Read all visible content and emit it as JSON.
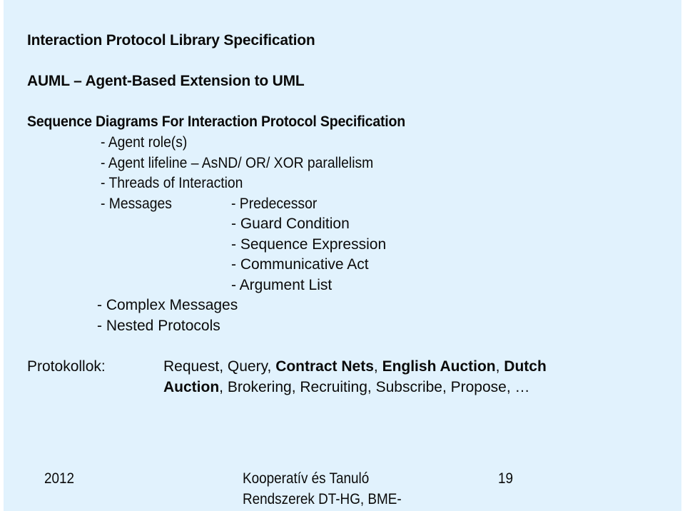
{
  "slide": {
    "headings": [
      "Interaction Protocol Library Specification",
      "AUML – Agent-Based Extension to UML",
      "Sequence Diagrams For Interaction Protocol Specification"
    ],
    "sequence_items": [
      "- Agent role(s)",
      "- Agent lifeline – AsND/ OR/ XOR parallelism",
      "- Threads of Interaction",
      "- Messages"
    ],
    "message_subitems": [
      "- Predecessor",
      "- Guard Condition",
      "- Sequence Expression",
      "- Communicative Act",
      "- Argument List"
    ],
    "more_items": [
      "- Complex Messages",
      "- Nested Protocols"
    ],
    "protocols": {
      "label": "Protokollok:",
      "line1": [
        {
          "text": "Request, Query, ",
          "bold": false
        },
        {
          "text": "Contract Nets",
          "bold": true
        },
        {
          "text": ", ",
          "bold": false
        },
        {
          "text": "English Auction",
          "bold": true
        },
        {
          "text": ", ",
          "bold": false
        },
        {
          "text": "Dutch",
          "bold": true
        }
      ],
      "line2": [
        {
          "text": "Auction",
          "bold": true
        },
        {
          "text": ", Brokering, Recruiting, Subscribe, Propose, …",
          "bold": false
        }
      ]
    },
    "footer": {
      "year": "2012",
      "course_line1": "Kooperatív és Tanuló",
      "course_line2": "Rendszerek DT-HG, BME-",
      "page_number": "19"
    },
    "colors": {
      "background": "#e1f2fd",
      "text": "#0a0a0a"
    }
  }
}
